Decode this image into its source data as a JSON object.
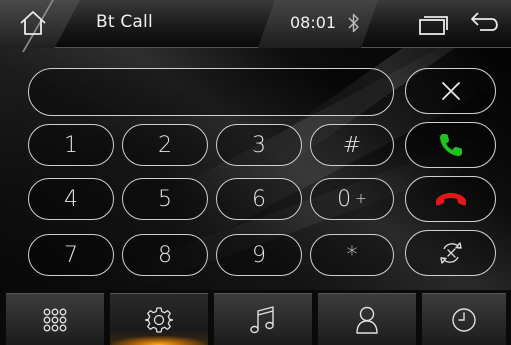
{
  "header": {
    "title": "Bt Call",
    "time": "08:01"
  },
  "dialpad": {
    "display_value": "",
    "keys": [
      {
        "main": "1",
        "sub": ""
      },
      {
        "main": "2",
        "sub": ""
      },
      {
        "main": "3",
        "sub": ""
      },
      {
        "main": "#",
        "sub": ""
      },
      {
        "main": "4",
        "sub": ""
      },
      {
        "main": "5",
        "sub": ""
      },
      {
        "main": "6",
        "sub": ""
      },
      {
        "main": "0",
        "sub": "+"
      },
      {
        "main": "7",
        "sub": ""
      },
      {
        "main": "8",
        "sub": ""
      },
      {
        "main": "9",
        "sub": ""
      },
      {
        "main": "*",
        "sub": ""
      }
    ]
  },
  "side_buttons": {
    "clear": "clear-icon",
    "call": "phone-answer-icon",
    "hangup": "phone-hangup-icon",
    "transfer": "transfer-icon"
  },
  "bottom_tabs": [
    {
      "name": "dialpad",
      "icon": "grid-dots-icon",
      "active": false
    },
    {
      "name": "settings",
      "icon": "gear-icon",
      "active": true
    },
    {
      "name": "music",
      "icon": "music-note-icon",
      "active": false
    },
    {
      "name": "contacts",
      "icon": "person-icon",
      "active": false
    },
    {
      "name": "call-history",
      "icon": "clock-icon",
      "active": false
    }
  ],
  "colors": {
    "call_green": "#1fc21f",
    "hangup_red": "#e01818",
    "active_glow": "#ffb020"
  }
}
